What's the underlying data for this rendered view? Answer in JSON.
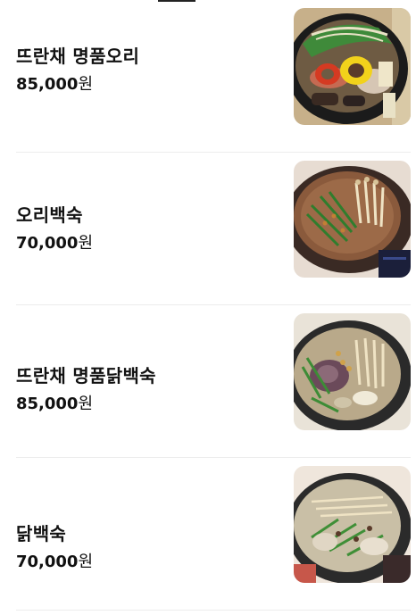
{
  "menu": {
    "items": [
      {
        "name": "뜨란채 명품오리",
        "price": "85,000",
        "currency": "원",
        "image_icon": "duck-hotpot-photo"
      },
      {
        "name": "오리백숙",
        "price": "70,000",
        "currency": "원",
        "image_icon": "duck-stew-photo"
      },
      {
        "name": "뜨란채 명품닭백숙",
        "price": "85,000",
        "currency": "원",
        "image_icon": "chicken-hotpot-photo"
      },
      {
        "name": "닭백숙",
        "price": "70,000",
        "currency": "원",
        "image_icon": "chicken-stew-photo"
      }
    ]
  },
  "colors": {
    "text": "#111111",
    "divider": "#ececec",
    "background": "#ffffff"
  }
}
